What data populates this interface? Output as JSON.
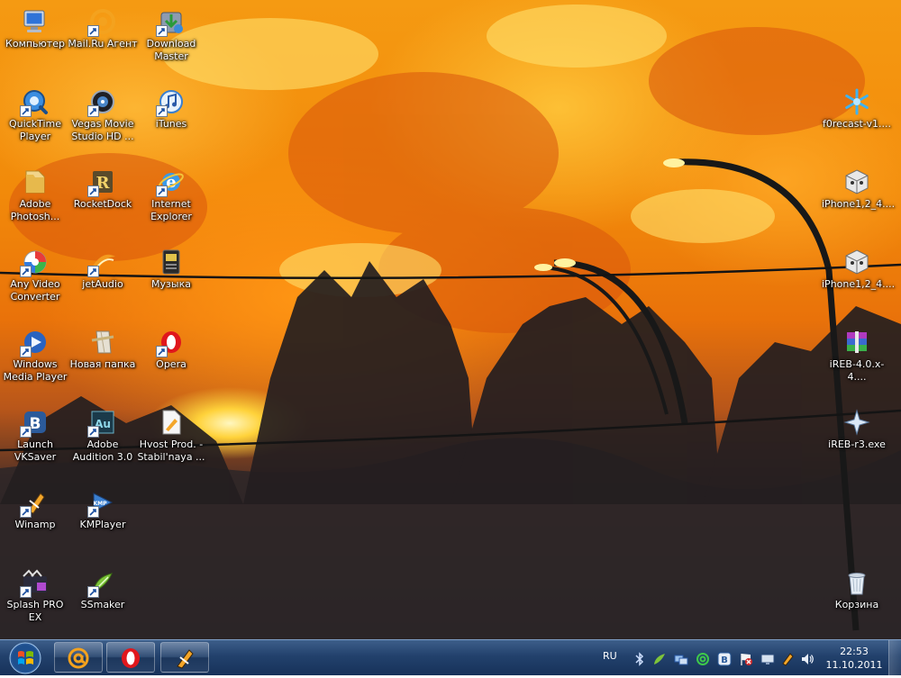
{
  "desktop": {
    "icons": [
      {
        "label": "Компьютер"
      },
      {
        "label": "Mail.Ru Агент"
      },
      {
        "label": "Download\nMaster"
      },
      {
        "label": "QuickTime\nPlayer"
      },
      {
        "label": "Vegas Movie\nStudio HD ..."
      },
      {
        "label": "iTunes"
      },
      {
        "label": "Adobe\nPhotosh..."
      },
      {
        "label": "RocketDock"
      },
      {
        "label": "Internet\nExplorer"
      },
      {
        "label": "Any Video\nConverter"
      },
      {
        "label": "jetAudio"
      },
      {
        "label": "Музыка"
      },
      {
        "label": "Windows\nMedia Player"
      },
      {
        "label": "Новая папка"
      },
      {
        "label": "Opera"
      },
      {
        "label": "Launch\nVKSaver"
      },
      {
        "label": "Adobe\nAudition 3.0"
      },
      {
        "label": "Hvost Prod. -\nStabil'naya ..."
      },
      {
        "label": "Winamp"
      },
      {
        "label": "KMPlayer"
      },
      {
        "label": "Splash PRO\nEX"
      },
      {
        "label": "SSmaker"
      },
      {
        "label": "f0recast-v1...."
      },
      {
        "label": "iPhone1,2_4...."
      },
      {
        "label": "iPhone1,2_4...."
      },
      {
        "label": "iREB-4.0.x-4...."
      },
      {
        "label": "iREB-r3.exe"
      },
      {
        "label": "Корзина"
      }
    ]
  },
  "taskbar": {
    "language": "RU",
    "clock_time": "22:53",
    "clock_date": "11.10.2011",
    "pinned": [
      "mail-ru-agent",
      "opera",
      "winamp"
    ]
  }
}
